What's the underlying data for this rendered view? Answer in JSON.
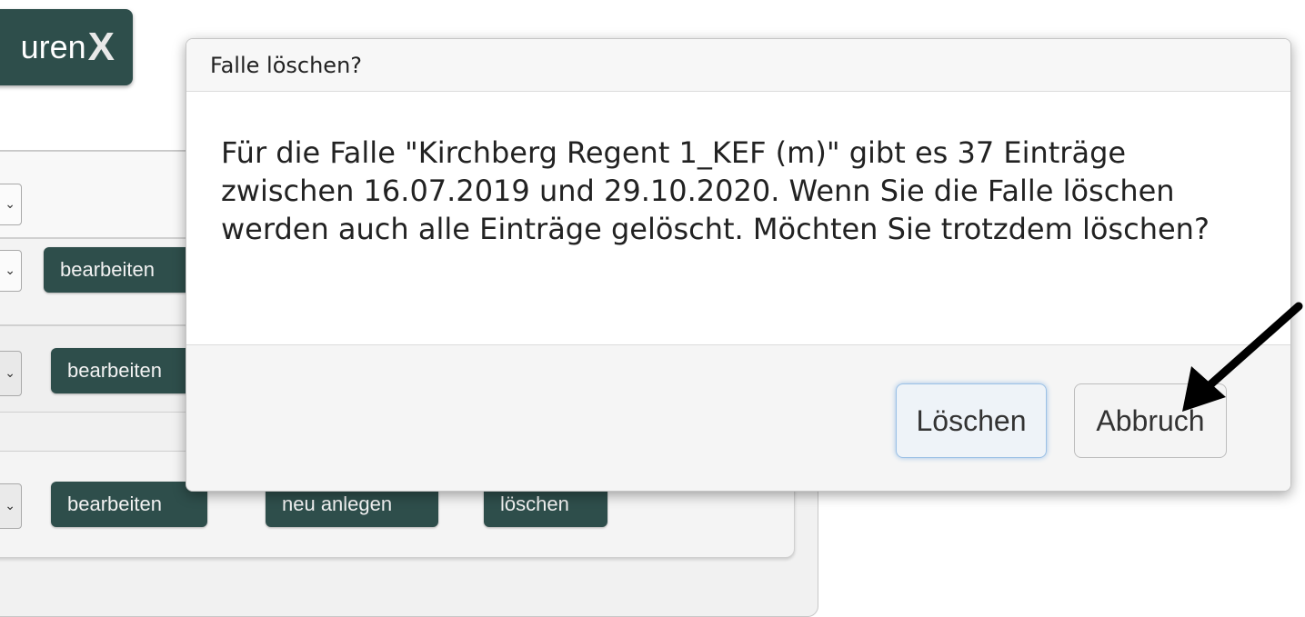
{
  "background": {
    "logo_text": "uren",
    "logo_mark": "X",
    "rows": [
      {
        "edit_label": "bearbeiten"
      },
      {
        "edit_label": "bearbeiten"
      },
      {
        "edit_label": "bearbeiten",
        "new_label": "neu anlegen",
        "delete_label": "löschen"
      }
    ]
  },
  "dialog": {
    "title": "Falle löschen?",
    "message": "Für die Falle \"Kirchberg Regent 1_KEF (m)\" gibt es 37 Einträge zwischen 16.07.2019 und 29.10.2020. Wenn Sie die Falle löschen werden auch alle Einträge gelöscht. Möchten Sie trotzdem löschen?",
    "delete_button": "Löschen",
    "cancel_button": "Abbruch"
  },
  "colors": {
    "button_dark": "#2e4e4b",
    "focus_ring": "#9cc1e6"
  },
  "icons": {
    "annotation": "arrow-icon"
  }
}
